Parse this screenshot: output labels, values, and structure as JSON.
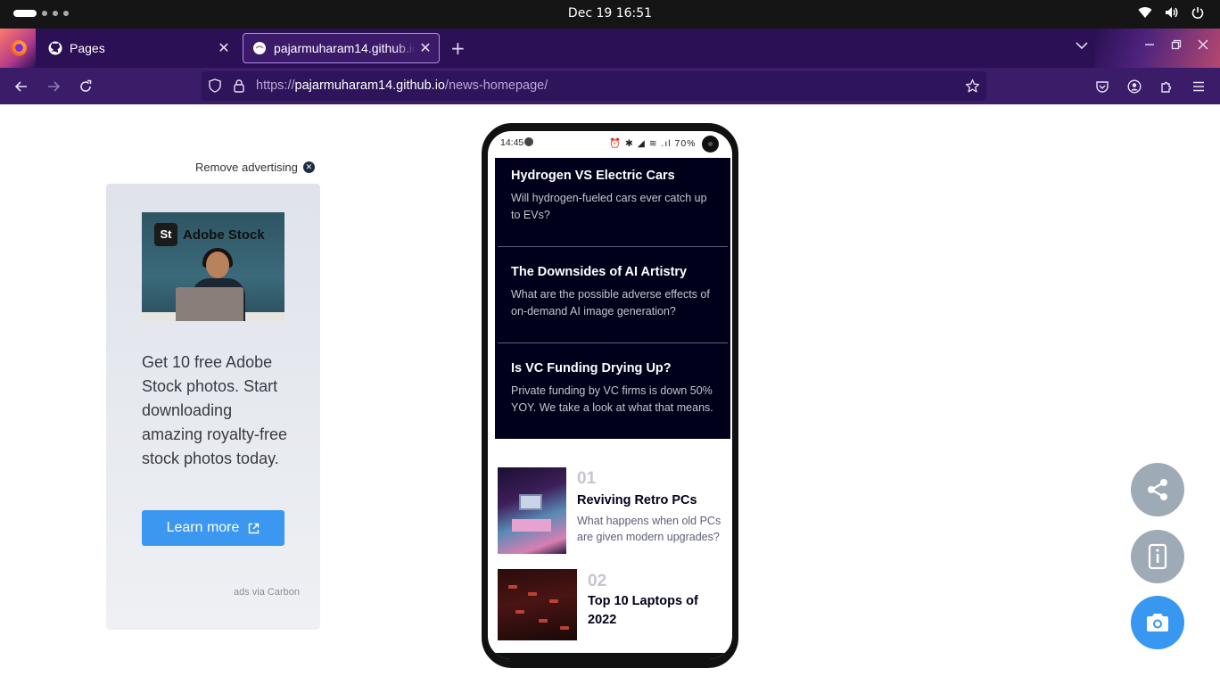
{
  "os": {
    "clock": "Dec 19  16:51"
  },
  "browser": {
    "tabs": [
      {
        "label": "Pages",
        "icon": "github-icon"
      },
      {
        "label": "pajarmuharam14.github.io",
        "icon": "site-icon"
      }
    ],
    "url": {
      "scheme": "https://",
      "host": "pajarmuharam14.github.io",
      "path": "/news-homepage/"
    }
  },
  "ad": {
    "remove_label": "Remove advertising",
    "brand_badge": "St",
    "brand_name": "Adobe Stock",
    "copy": "Get 10 free Adobe Stock photos. Start downloading amazing royalty-free stock photos today.",
    "cta_label": "Learn more",
    "via": "ads via Carbon"
  },
  "phone": {
    "status_time": "14:45",
    "status_icons": "⏰ ✱ ◢ ≋ .ıl 70%",
    "new_items": [
      {
        "title": "Hydrogen VS Electric Cars",
        "desc": "Will hydrogen-fueled cars ever catch up to EVs?"
      },
      {
        "title": "The Downsides of AI Artistry",
        "desc": "What are the possible adverse effects of on-demand AI image generation?"
      },
      {
        "title": "Is VC Funding Drying Up?",
        "desc": "Private funding by VC firms is down 50% YOY. We take a look at what that means."
      }
    ],
    "ranked": [
      {
        "num": "01",
        "title": "Reviving Retro PCs",
        "desc": "What happens when old PCs are given modern upgrades?"
      },
      {
        "num": "02",
        "title": "Top 10 Laptops of 2022",
        "desc": ""
      }
    ]
  },
  "colors": {
    "tab_strip": "#2b1055",
    "nav_bar": "#3a1c69",
    "dark_box": "#00001a",
    "fab_grey": "#9eaab5",
    "fab_blue": "#3897f0",
    "ad_button": "#3b97f0"
  }
}
